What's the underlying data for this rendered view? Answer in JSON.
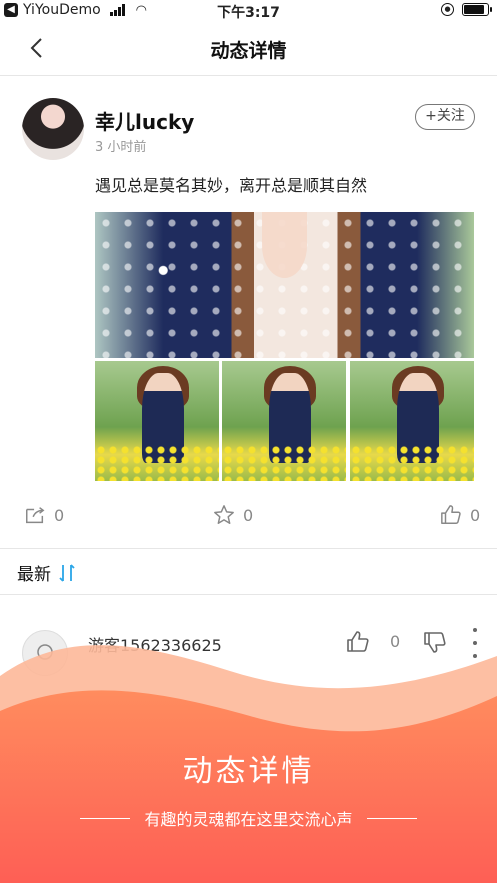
{
  "status_bar": {
    "app_name": "YiYouDemo",
    "time": "下午3:17",
    "battery_level": 0.85
  },
  "nav": {
    "title": "动态详情"
  },
  "post": {
    "author": "幸儿lucky",
    "time": "3 小时前",
    "follow_label": "+关注",
    "text": "遇见总是莫名其妙，离开总是顺其自然",
    "share_count": "0",
    "star_count": "0",
    "like_count": "0"
  },
  "comments_section": {
    "sort_label": "最新",
    "comments": [
      {
        "user": "游客1562336625",
        "like_count": "0"
      }
    ]
  },
  "banner": {
    "title": "动态详情",
    "subtitle": "有趣的灵魂都在这里交流心声",
    "colors": {
      "top": "#fdb899",
      "middle": "#ff8c5e",
      "bottom": "#fe5f55"
    }
  },
  "colors": {
    "accent_blue": "#2aa6e8",
    "divider": "#e6e6e6",
    "muted_text": "#999999"
  }
}
